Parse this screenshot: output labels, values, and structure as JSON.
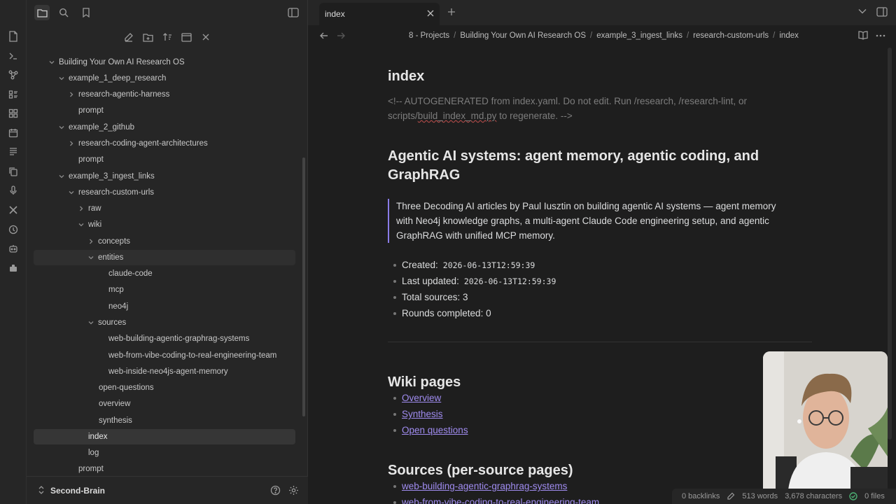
{
  "sidebar": {
    "tree": [
      {
        "label": "Building Your Own AI Research OS",
        "depth": 0,
        "expanded": true
      },
      {
        "label": "example_1_deep_research",
        "depth": 1,
        "expanded": true
      },
      {
        "label": "research-agentic-harness",
        "depth": 2,
        "expanded": false
      },
      {
        "label": "prompt",
        "depth": 2
      },
      {
        "label": "example_2_github",
        "depth": 1,
        "expanded": true
      },
      {
        "label": "research-coding-agent-architectures",
        "depth": 2,
        "expanded": false
      },
      {
        "label": "prompt",
        "depth": 2
      },
      {
        "label": "example_3_ingest_links",
        "depth": 1,
        "expanded": true
      },
      {
        "label": "research-custom-urls",
        "depth": 2,
        "expanded": true
      },
      {
        "label": "raw",
        "depth": 3,
        "expanded": false
      },
      {
        "label": "wiki",
        "depth": 3,
        "expanded": true
      },
      {
        "label": "concepts",
        "depth": 4,
        "expanded": false
      },
      {
        "label": "entities",
        "depth": 4,
        "expanded": true
      },
      {
        "label": "claude-code",
        "depth": 5
      },
      {
        "label": "mcp",
        "depth": 5
      },
      {
        "label": "neo4j",
        "depth": 5
      },
      {
        "label": "sources",
        "depth": 4,
        "expanded": true
      },
      {
        "label": "web-building-agentic-graphrag-systems",
        "depth": 5
      },
      {
        "label": "web-from-vibe-coding-to-real-engineering-team",
        "depth": 5
      },
      {
        "label": "web-inside-neo4js-agent-memory",
        "depth": 5
      },
      {
        "label": "open-questions",
        "depth": 4
      },
      {
        "label": "overview",
        "depth": 4
      },
      {
        "label": "synthesis",
        "depth": 4
      },
      {
        "label": "index",
        "depth": 3
      },
      {
        "label": "log",
        "depth": 3
      },
      {
        "label": "prompt",
        "depth": 2
      }
    ],
    "vault_name": "Second-Brain"
  },
  "tab": {
    "title": "index"
  },
  "breadcrumbs": [
    "8 - Projects",
    "Building Your Own AI Research OS",
    "example_3_ingest_links",
    "research-custom-urls",
    "index"
  ],
  "note": {
    "title": "index",
    "comment_line1": "<!-- AUTOGENERATED from index.yaml. Do not edit. Run /research, /research-lint, or",
    "comment_pre": "scripts/",
    "comment_spell": "build_index_md.py",
    "comment_post": " to regenerate. -->",
    "heading_line1": "Agentic AI systems: agent memory, agentic coding, and",
    "heading_line2": "GraphRAG",
    "quote_line1": "Three Decoding AI articles by Paul Iusztin on building agentic AI systems — agent memory",
    "quote_line2": "with Neo4j knowledge graphs, a multi-agent Claude Code engineering setup, and agentic",
    "quote_line3": "GraphRAG with unified MCP memory.",
    "meta": [
      {
        "label": "Created:",
        "code": "2026-06-13T12:59:39"
      },
      {
        "label": "Last updated:",
        "code": "2026-06-13T12:59:39"
      },
      {
        "label": "Total sources: 3",
        "code": ""
      },
      {
        "label": "Rounds completed: 0",
        "code": ""
      }
    ],
    "wiki_heading": "Wiki pages",
    "wiki_links": [
      "Overview",
      "Synthesis",
      "Open questions"
    ],
    "sources_heading": "Sources (per-source pages)",
    "source_links": [
      "web-building-agentic-graphrag-systems",
      "web-from-vibe-coding-to-real-engineering-team"
    ]
  },
  "status": {
    "backlinks": "0 backlinks",
    "words": "513 words",
    "characters": "3,678 characters",
    "files": "0 files"
  },
  "colors": {
    "accent": "#a08cf0",
    "quote_border": "#8a7ce8",
    "background": "#1e1e1e",
    "sidebar": "#262626"
  }
}
